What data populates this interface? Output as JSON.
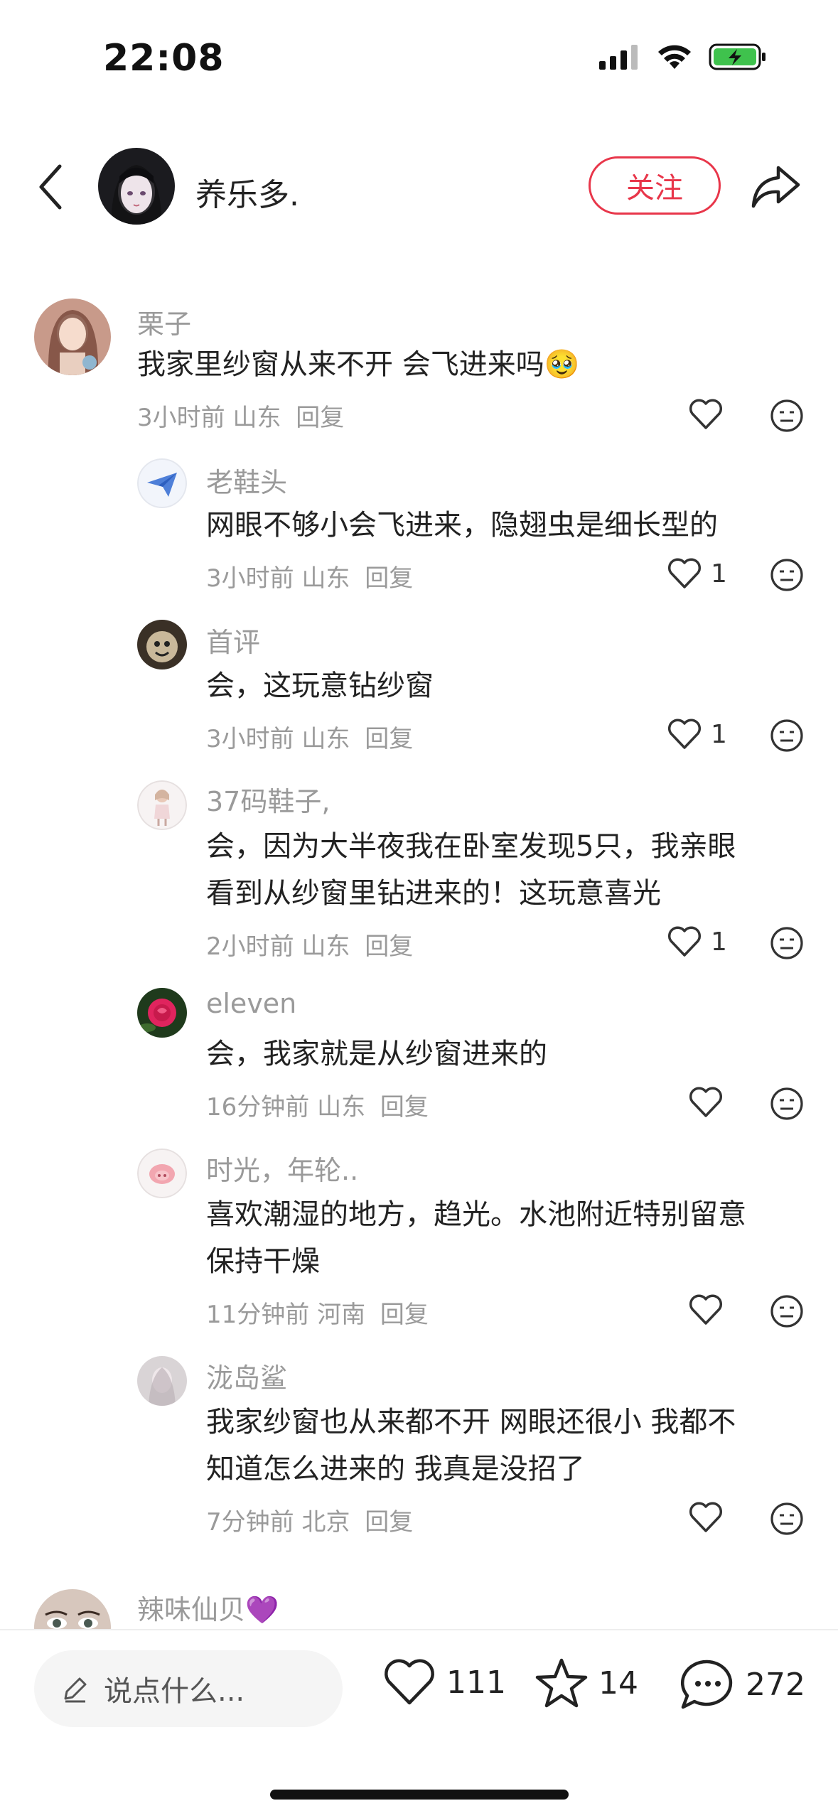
{
  "status_bar": {
    "time": "22:08"
  },
  "header": {
    "author_name": "养乐多.",
    "follow_label": "关注"
  },
  "comments": [
    {
      "name": "栗子",
      "text_lines": [
        "我家里纱窗从来不开 会飞进来吗🥹"
      ],
      "meta": "3小时前 山东",
      "reply": "回复",
      "likes": ""
    },
    {
      "name": "老鞋头",
      "text_lines": [
        "网眼不够小会飞进来，隐翅虫是细长型的"
      ],
      "meta": "3小时前 山东",
      "reply": "回复",
      "likes": "1"
    },
    {
      "name": "首评",
      "text_lines": [
        "会，这玩意钻纱窗"
      ],
      "meta": "3小时前 山东",
      "reply": "回复",
      "likes": "1"
    },
    {
      "name": "37码鞋子,",
      "text_lines": [
        "会，因为大半夜我在卧室发现5只，我亲眼",
        "看到从纱窗里钻进来的！这玩意喜光"
      ],
      "meta": "2小时前 山东",
      "reply": "回复",
      "likes": "1"
    },
    {
      "name": "eleven",
      "text_lines": [
        "会，我家就是从纱窗进来的"
      ],
      "meta": "16分钟前 山东",
      "reply": "回复",
      "likes": ""
    },
    {
      "name": "时光，年轮..",
      "text_lines": [
        "喜欢潮湿的地方，趋光。水池附近特别留意",
        "保持干燥"
      ],
      "meta": "11分钟前 河南",
      "reply": "回复",
      "likes": ""
    },
    {
      "name": "泷岛鲨",
      "text_lines": [
        "我家纱窗也从来都不开  网眼还很小  我都不",
        "知道怎么进来的  我真是没招了"
      ],
      "meta": "7分钟前 北京",
      "reply": "回复",
      "likes": ""
    },
    {
      "name": "辣味仙贝💜",
      "text_lines": [],
      "meta": "",
      "reply": "",
      "likes": ""
    }
  ],
  "bottom_bar": {
    "input_placeholder": "说点什么...",
    "likes": "111",
    "favorites": "14",
    "comments": "272"
  },
  "colors": {
    "accent": "#e8364a",
    "muted": "#9a9a9a"
  }
}
